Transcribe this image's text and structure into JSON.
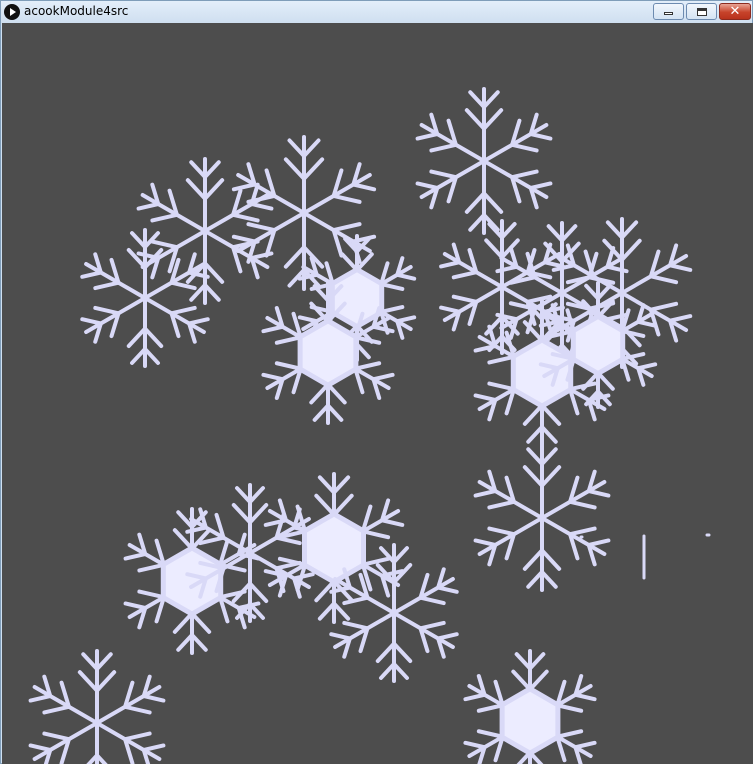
{
  "window": {
    "title": "acookModule4src",
    "controls": {
      "minimize": "minimize-icon",
      "maximize": "maximize-icon",
      "close": "close-icon"
    }
  },
  "canvas": {
    "background": "#4d4d4d",
    "snowflake_color": "#d9d9f7",
    "hexagon_fill": "#ececff"
  }
}
